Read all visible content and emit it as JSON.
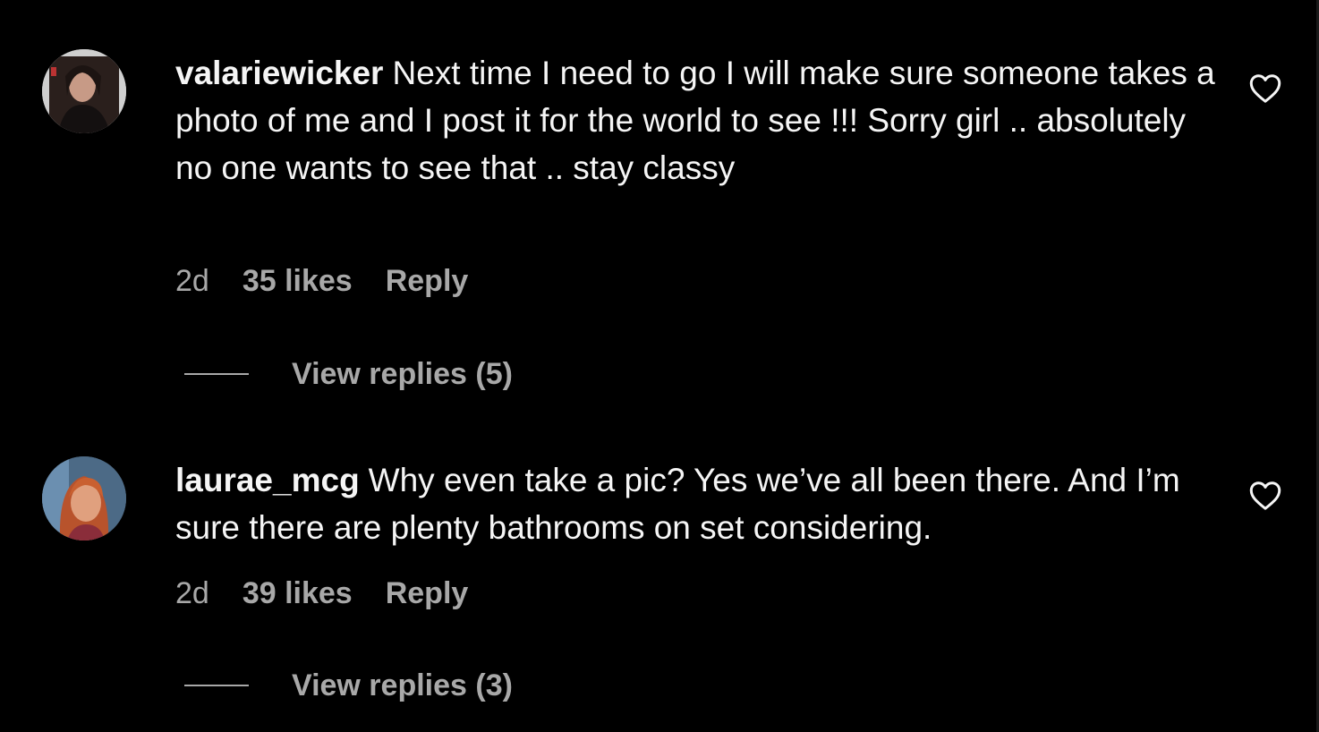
{
  "theme": {
    "background": "#000000",
    "text_primary": "#f5f5f5",
    "text_secondary": "#a8a8a8"
  },
  "comments": [
    {
      "username": "valariewicker",
      "text": "Next time I need to go I will make sure someone takes a photo of me and I post it for the world to see !!! Sorry girl .. absolutely no one wants to see that .. stay classy",
      "time": "2d",
      "likes": "35 likes",
      "reply_label": "Reply",
      "view_replies_label": "View replies (5)",
      "like_icon": "heart-outline-icon"
    },
    {
      "username": "laurae_mcg",
      "text": "Why even take a pic? Yes we’ve all been there. And I’m sure there are plenty bathrooms on set considering.",
      "time": "2d",
      "likes": "39 likes",
      "reply_label": "Reply",
      "view_replies_label": "View replies (3)",
      "like_icon": "heart-outline-icon"
    }
  ]
}
